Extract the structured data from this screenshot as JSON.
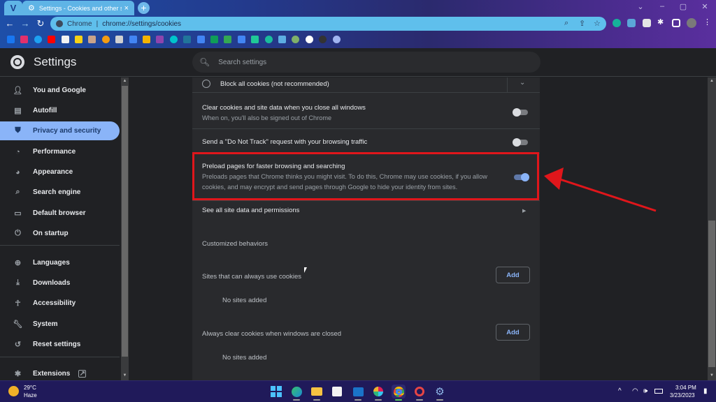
{
  "browser": {
    "app_badge": "V",
    "tab": {
      "title": "Settings - Cookies and other site data",
      "close": "×"
    },
    "new_tab": "+",
    "window_controls": {
      "menu": "⌄",
      "minimize": "–",
      "maximize": "▢",
      "close": "✕"
    },
    "nav": {
      "back": "←",
      "forward": "→",
      "reload": "↻"
    },
    "omnibox": {
      "origin": "Chrome",
      "separator": "|",
      "url": "chrome://settings/cookies"
    },
    "bookmarks": [
      "facebook",
      "instagram",
      "twitter",
      "youtube",
      "amazon",
      "flipkart",
      "profile",
      "blogger",
      "store",
      "google-ads",
      "analytics",
      "stats",
      "canva",
      "wordpress",
      "google-docs",
      "google-sheets",
      "google-drive",
      "translate",
      "sheets-ext",
      "signal",
      "cloud",
      "reload-ext",
      "google",
      "moon-ext",
      "settings-ext"
    ]
  },
  "header": {
    "title": "Settings",
    "search": {
      "placeholder": "Search settings",
      "value": ""
    }
  },
  "sidebar": {
    "items": [
      {
        "label": "You and Google",
        "icon": "person-icon",
        "active": false
      },
      {
        "label": "Autofill",
        "icon": "clipboard-icon",
        "active": false
      },
      {
        "label": "Privacy and security",
        "icon": "shield-icon",
        "active": true
      },
      {
        "label": "Performance",
        "icon": "speedometer-icon",
        "active": false
      },
      {
        "label": "Appearance",
        "icon": "palette-icon",
        "active": false
      },
      {
        "label": "Search engine",
        "icon": "search-icon",
        "active": false
      },
      {
        "label": "Default browser",
        "icon": "browser-icon",
        "active": false
      },
      {
        "label": "On startup",
        "icon": "power-icon",
        "active": false
      },
      {
        "label": "Languages",
        "icon": "globe-icon",
        "active": false
      },
      {
        "label": "Downloads",
        "icon": "download-icon",
        "active": false
      },
      {
        "label": "Accessibility",
        "icon": "accessibility-icon",
        "active": false
      },
      {
        "label": "System",
        "icon": "wrench-icon",
        "active": false
      },
      {
        "label": "Reset settings",
        "icon": "history-icon",
        "active": false
      },
      {
        "label": "Extensions",
        "icon": "puzzle-icon",
        "active": false
      }
    ]
  },
  "content": {
    "block_all": {
      "label": "Block all cookies (not recommended)",
      "selected": false
    },
    "clear_on_close": {
      "label": "Clear cookies and site data when you close all windows",
      "sublabel": "When on, you'll also be signed out of Chrome",
      "enabled": false
    },
    "do_not_track": {
      "label": "Send a \"Do Not Track\" request with your browsing traffic",
      "enabled": false
    },
    "preload": {
      "label": "Preload pages for faster browsing and searching",
      "sublabel_line1": "Preloads pages that Chrome thinks you might visit. To do this, Chrome may use cookies, if you allow",
      "sublabel_line2": "cookies, and may encrypt and send pages through Google to hide your identity from sites.",
      "enabled": true
    },
    "see_all": {
      "label": "See all site data and permissions"
    },
    "customized": {
      "title": "Customized behaviors",
      "allow": {
        "label": "Sites that can always use cookies",
        "add": "Add",
        "empty": "No sites added"
      },
      "clear": {
        "label": "Always clear cookies when windows are closed",
        "add": "Add",
        "empty": "No sites added"
      }
    }
  },
  "annotation": {
    "highlight_color": "#e0161b"
  },
  "taskbar": {
    "weather": {
      "temp": "29°C",
      "desc": "Haze"
    },
    "apps": [
      "windows-start",
      "edge",
      "file-explorer",
      "ms-store",
      "outlook",
      "slack",
      "chrome",
      "opera",
      "settings"
    ],
    "active_app": "chrome",
    "tray": {
      "chevron": "^",
      "wifi": "wifi",
      "volume": "volume",
      "battery": "battery"
    },
    "clock": {
      "time": "3:04 PM",
      "date": "3/23/2023"
    }
  }
}
